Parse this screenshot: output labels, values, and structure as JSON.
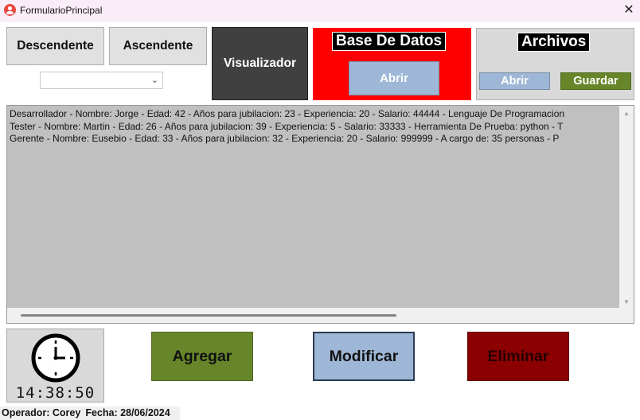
{
  "window": {
    "title": "FormularioPrincipal",
    "close_glyph": "✕",
    "app_icon": "user-icon"
  },
  "sort": {
    "descending_label": "Descendente",
    "ascending_label": "Ascendente",
    "combo_value": ""
  },
  "viewer": {
    "label": "Visualizador"
  },
  "database": {
    "title": "Base De Datos",
    "open_label": "Abrir"
  },
  "files": {
    "title": "Archivos",
    "open_label": "Abrir",
    "save_label": "Guardar"
  },
  "list": {
    "items": [
      "Desarrollador - Nombre: Jorge - Edad: 42 - Años para jubilacion: 23 - Experiencia: 20 - Salario: 44444 - Lenguaje De Programacion",
      "Tester - Nombre: Martin - Edad: 26 - Años para jubilacion: 39 - Experiencia: 5 - Salario: 33333 - Herramienta De Prueba: python - T",
      "Gerente - Nombre: Eusebio - Edad: 33 - Años para jubilacion: 32 - Experiencia: 20 - Salario: 999999 - A cargo de: 35 personas - P"
    ]
  },
  "clock": {
    "time": "14:38:50",
    "icon": "clock-icon"
  },
  "actions": {
    "add_label": "Agregar",
    "modify_label": "Modificar",
    "delete_label": "Eliminar"
  },
  "status": {
    "operator": "Operador: Corey",
    "date": "Fecha: 28/06/2024"
  },
  "colors": {
    "database_panel": "#ff0000",
    "add_button": "#67862a",
    "modify_button": "#9eb7d6",
    "delete_button": "#8b0000",
    "viewer_button": "#404040"
  }
}
